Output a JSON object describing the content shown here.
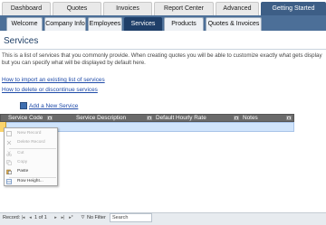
{
  "top_tabs": [
    "Dashboard",
    "Quotes",
    "Invoices",
    "Report Center",
    "Advanced",
    "Getting Started"
  ],
  "top_tabs_active": "Getting Started",
  "sub_tabs": [
    "Welcome",
    "Company Info",
    "Employees",
    "Services",
    "Products",
    "Quotes & Invoices"
  ],
  "sub_tabs_active": "Services",
  "page_title": "Services",
  "description_line1": "This is a list of services that you commonly provide.  When creating quotes you will be able to customize exactly what gets display",
  "description_line2": "but you can specify what will be displayed by default here.",
  "links": {
    "import": "How to import an existing list of services",
    "delete": "How to delete or discontinue services",
    "add": "Add a  New Service"
  },
  "grid_columns": [
    "Service Code",
    "Service Description",
    "Default Hourly Rate",
    "Notes"
  ],
  "context_menu": [
    {
      "label": "New Record",
      "icon": "new-record-icon",
      "enabled": false
    },
    {
      "label": "Delete Record",
      "icon": "delete-record-icon",
      "enabled": false
    },
    {
      "label": "Cut",
      "icon": "scissors-icon",
      "enabled": false
    },
    {
      "label": "Copy",
      "icon": "copy-icon",
      "enabled": false
    },
    {
      "label": "Paste",
      "icon": "paste-icon",
      "enabled": true
    },
    {
      "label": "Row Height...",
      "icon": "row-height-icon",
      "enabled": true
    }
  ],
  "status_bar": {
    "record_label": "Record:",
    "record_position": "1 of 1",
    "filter": "No Filter",
    "search_placeholder": "Search"
  },
  "colors": {
    "band": "#4c6f98",
    "active_tab": "#1f3f69",
    "link": "#1e4aa8",
    "grid_header": "#6a6a6a",
    "selected_row": "#d0e4fb"
  }
}
